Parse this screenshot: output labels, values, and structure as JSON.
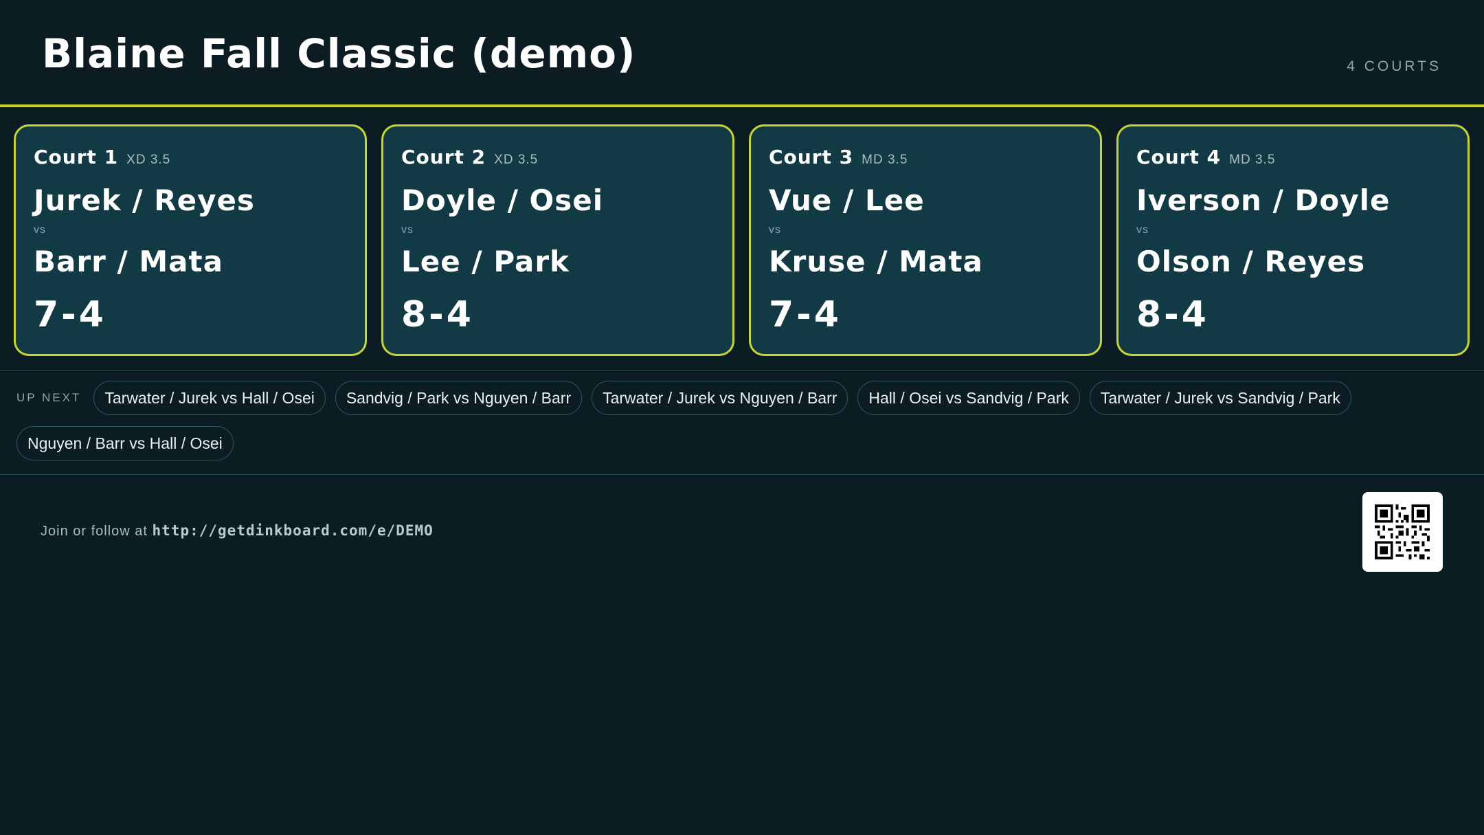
{
  "header": {
    "title": "Blaine Fall Classic (demo)",
    "courts_count": "4 COURTS"
  },
  "courts": [
    {
      "name": "Court 1",
      "division": "XD 3.5",
      "team_a": "Jurek / Reyes",
      "vs": "vs",
      "team_b": "Barr / Mata",
      "score": "7-4"
    },
    {
      "name": "Court 2",
      "division": "XD 3.5",
      "team_a": "Doyle / Osei",
      "vs": "vs",
      "team_b": "Lee / Park",
      "score": "8-4"
    },
    {
      "name": "Court 3",
      "division": "MD 3.5",
      "team_a": "Vue / Lee",
      "vs": "vs",
      "team_b": "Kruse / Mata",
      "score": "7-4"
    },
    {
      "name": "Court 4",
      "division": "MD 3.5",
      "team_a": "Iverson / Doyle",
      "vs": "vs",
      "team_b": "Olson / Reyes",
      "score": "8-4"
    }
  ],
  "up_next": {
    "label": "UP NEXT",
    "matches": [
      "Tarwater / Jurek vs Hall / Osei",
      "Sandvig / Park vs Nguyen / Barr",
      "Tarwater / Jurek vs Nguyen / Barr",
      "Hall / Osei vs Sandvig / Park",
      "Tarwater / Jurek vs Sandvig / Park",
      "Nguyen / Barr vs Hall / Osei"
    ]
  },
  "footer": {
    "join_text": "Join or follow at",
    "url": "http://getdinkboard.com/e/DEMO",
    "qr_icon": "qr-code-icon"
  },
  "colors": {
    "background": "#0b1d22",
    "card": "#123a44",
    "accent": "#c8d62b"
  }
}
